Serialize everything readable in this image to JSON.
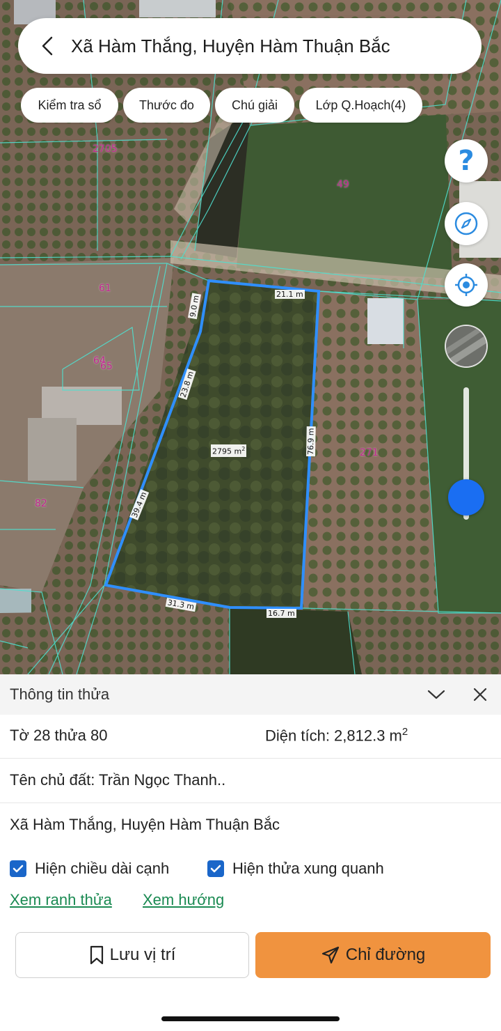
{
  "header": {
    "title": "Xã Hàm Thắng, Huyện Hàm Thuận Bắc"
  },
  "chips": [
    {
      "label": "Kiểm tra sổ"
    },
    {
      "label": "Thước đo"
    },
    {
      "label": "Chú giải"
    },
    {
      "label": "Lớp Q.Hoạch(4)"
    }
  ],
  "map": {
    "parcel_numbers": [
      "2705",
      "49",
      "61",
      "64",
      "65",
      "82",
      "271"
    ],
    "edge_lengths": [
      "21.1 m",
      "9.0 m",
      "23.8 m",
      "76.9 m",
      "39.4 m",
      "31.3 m",
      "16.7 m"
    ],
    "area_label": "2795 m",
    "area_sup": "2",
    "highlight_color": "#2f8fff",
    "slider_value": 0.83
  },
  "sheet": {
    "title": "Thông tin thửa",
    "parcel_id": "Tờ 28 thửa 80",
    "area_prefix": "Diện tích: 2,812.3 m",
    "area_sup": "2",
    "owner": "Tên chủ đất: Trần Ngọc Thanh..",
    "address": "Xã Hàm Thắng, Huyện Hàm Thuận Bắc",
    "checkbox_edges": "Hiện chiều dài cạnh",
    "checkbox_neighbors": "Hiện thửa xung quanh",
    "link_boundary": "Xem ranh thửa",
    "link_direction": "Xem hướng"
  },
  "actions": {
    "save_label": "Lưu vị trí",
    "navigate_label": "Chỉ đường",
    "navigate_color": "#f0933f"
  }
}
